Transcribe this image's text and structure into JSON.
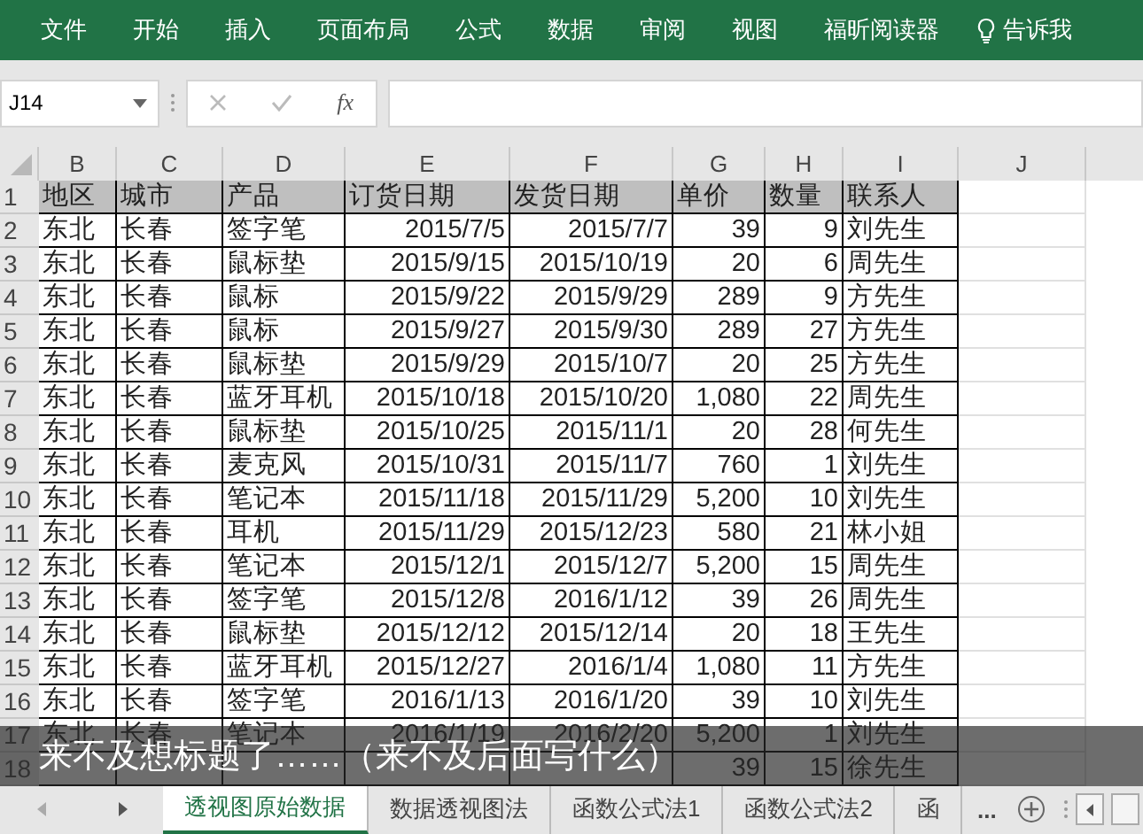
{
  "menu": [
    "文件",
    "开始",
    "插入",
    "页面布局",
    "公式",
    "数据",
    "审阅",
    "视图",
    "福昕阅读器"
  ],
  "tell_me": "告诉我",
  "formula_bar": {
    "name_box": "J14",
    "function_label": "fx"
  },
  "sheet": {
    "columns": [
      {
        "letter": "B",
        "kind": "text"
      },
      {
        "letter": "C",
        "kind": "text"
      },
      {
        "letter": "D",
        "kind": "text"
      },
      {
        "letter": "E",
        "kind": "number"
      },
      {
        "letter": "F",
        "kind": "number"
      },
      {
        "letter": "G",
        "kind": "number"
      },
      {
        "letter": "H",
        "kind": "number"
      },
      {
        "letter": "I",
        "kind": "text"
      },
      {
        "letter": "J",
        "kind": "empty"
      }
    ],
    "header": {
      "number": "1",
      "cells": [
        "地区",
        "城市",
        "产品",
        "订货日期",
        "发货日期",
        "单价",
        "数量",
        "联系人"
      ]
    },
    "rows": [
      {
        "number": "2",
        "cells": [
          "东北",
          "长春",
          "签字笔",
          "2015/7/5",
          "2015/7/7",
          "39",
          "9",
          "刘先生"
        ]
      },
      {
        "number": "3",
        "cells": [
          "东北",
          "长春",
          "鼠标垫",
          "2015/9/15",
          "2015/10/19",
          "20",
          "6",
          "周先生"
        ]
      },
      {
        "number": "4",
        "cells": [
          "东北",
          "长春",
          "鼠标",
          "2015/9/22",
          "2015/9/29",
          "289",
          "9",
          "方先生"
        ]
      },
      {
        "number": "5",
        "cells": [
          "东北",
          "长春",
          "鼠标",
          "2015/9/27",
          "2015/9/30",
          "289",
          "27",
          "方先生"
        ]
      },
      {
        "number": "6",
        "cells": [
          "东北",
          "长春",
          "鼠标垫",
          "2015/9/29",
          "2015/10/7",
          "20",
          "25",
          "方先生"
        ]
      },
      {
        "number": "7",
        "cells": [
          "东北",
          "长春",
          "蓝牙耳机",
          "2015/10/18",
          "2015/10/20",
          "1,080",
          "22",
          "周先生"
        ]
      },
      {
        "number": "8",
        "cells": [
          "东北",
          "长春",
          "鼠标垫",
          "2015/10/25",
          "2015/11/1",
          "20",
          "28",
          "何先生"
        ]
      },
      {
        "number": "9",
        "cells": [
          "东北",
          "长春",
          "麦克风",
          "2015/10/31",
          "2015/11/7",
          "760",
          "1",
          "刘先生"
        ]
      },
      {
        "number": "10",
        "cells": [
          "东北",
          "长春",
          "笔记本",
          "2015/11/18",
          "2015/11/29",
          "5,200",
          "10",
          "刘先生"
        ]
      },
      {
        "number": "11",
        "cells": [
          "东北",
          "长春",
          "耳机",
          "2015/11/29",
          "2015/12/23",
          "580",
          "21",
          "林小姐"
        ]
      },
      {
        "number": "12",
        "cells": [
          "东北",
          "长春",
          "笔记本",
          "2015/12/1",
          "2015/12/7",
          "5,200",
          "15",
          "周先生"
        ]
      },
      {
        "number": "13",
        "cells": [
          "东北",
          "长春",
          "签字笔",
          "2015/12/8",
          "2016/1/12",
          "39",
          "26",
          "周先生"
        ]
      },
      {
        "number": "14",
        "cells": [
          "东北",
          "长春",
          "鼠标垫",
          "2015/12/12",
          "2015/12/14",
          "20",
          "18",
          "王先生"
        ]
      },
      {
        "number": "15",
        "cells": [
          "东北",
          "长春",
          "蓝牙耳机",
          "2015/12/27",
          "2016/1/4",
          "1,080",
          "11",
          "方先生"
        ]
      },
      {
        "number": "16",
        "cells": [
          "东北",
          "长春",
          "签字笔",
          "2016/1/13",
          "2016/1/20",
          "39",
          "10",
          "刘先生"
        ]
      },
      {
        "number": "17",
        "cells": [
          "东北",
          "长春",
          "笔记本",
          "2016/1/19",
          "2016/2/20",
          "5,200",
          "1",
          "刘先生"
        ]
      },
      {
        "number": "18",
        "cells": [
          "",
          "",
          "",
          "",
          "",
          "39",
          "15",
          "徐先生"
        ]
      }
    ]
  },
  "caption": "来不及想标题了……（来不及后面写什么）",
  "sheet_tabs": [
    {
      "label": "透视图原始数据",
      "selected": true
    },
    {
      "label": "数据透视图法",
      "selected": false
    },
    {
      "label": "函数公式法1",
      "selected": false
    },
    {
      "label": "函数公式法2",
      "selected": false
    },
    {
      "label": "函",
      "selected": false
    }
  ],
  "more_tabs": "..."
}
